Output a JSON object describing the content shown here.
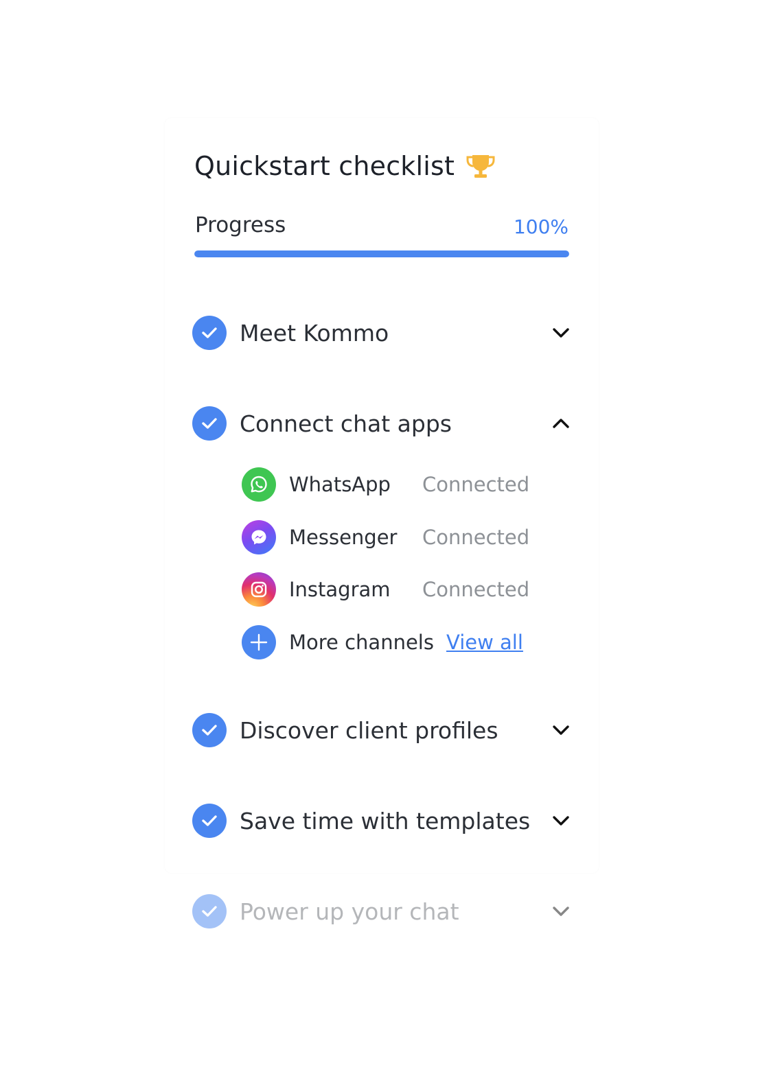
{
  "checklist": {
    "title": "Quickstart checklist",
    "trophy_icon": "trophy-icon",
    "progress": {
      "label": "Progress",
      "value_text": "100%",
      "fraction": 1.0
    },
    "sections": [
      {
        "label": "Meet Kommo",
        "completed": true,
        "expanded": false
      },
      {
        "label": "Connect chat apps",
        "completed": true,
        "expanded": true
      },
      {
        "label": "Discover client profiles",
        "completed": true,
        "expanded": false
      },
      {
        "label": "Save time with templates",
        "completed": true,
        "expanded": false
      },
      {
        "label": "Power up your chat",
        "completed": true,
        "expanded": false
      }
    ],
    "channels": [
      {
        "name": "WhatsApp",
        "status": "Connected",
        "icon": "whatsapp-icon"
      },
      {
        "name": "Messenger",
        "status": "Connected",
        "icon": "messenger-icon"
      },
      {
        "name": "Instagram",
        "status": "Connected",
        "icon": "instagram-icon"
      },
      {
        "name": "More channels",
        "link": "View all",
        "icon": "plus-icon"
      }
    ]
  },
  "colors": {
    "accent": "#4a86f0",
    "link": "#3f7ff0",
    "muted": "#8d9196",
    "trophy": "#f6b73c",
    "whatsapp": "#3fc652"
  }
}
